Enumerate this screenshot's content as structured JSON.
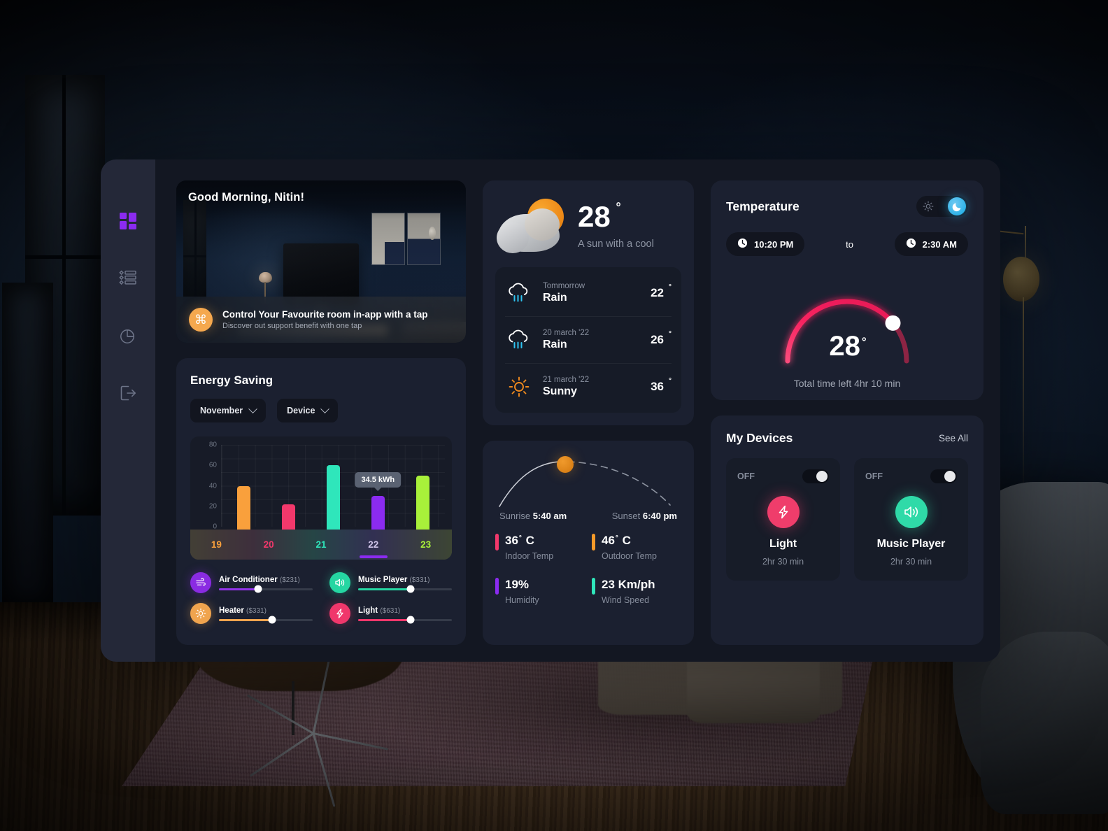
{
  "sidebar": {
    "items": [
      {
        "icon": "grid-dashboard-icon",
        "label": "Dashboard",
        "active": true
      },
      {
        "icon": "list-icon",
        "label": "Devices List",
        "active": false
      },
      {
        "icon": "pie-chart-icon",
        "label": "Statistics",
        "active": false
      },
      {
        "icon": "logout-icon",
        "label": "Log Out",
        "active": false
      }
    ]
  },
  "hero": {
    "greeting": "Good Morning, Nitin!",
    "banner_title": "Control Your Favourite room in-app with a tap",
    "banner_subtitle": "Discover out support benefit with one tap",
    "badge_icon": "command-icon",
    "badge_glyph": "⌘",
    "badge_color": "#f5a84e"
  },
  "energy": {
    "title": "Energy Saving",
    "filters": [
      {
        "label": "November",
        "icon": "chevron-down-icon"
      },
      {
        "label": "Device",
        "icon": "chevron-down-icon"
      }
    ],
    "tooltip": "34.5 kWh",
    "devices": [
      {
        "name": "Air Conditioner",
        "price": "($231)",
        "icon": "air-conditioner-icon",
        "color": "#8a2be2",
        "accent": "#9333ea",
        "value": 42
      },
      {
        "name": "Music Player",
        "price": "($331)",
        "icon": "speaker-icon",
        "color": "#25d6a2",
        "accent": "#25d6a2",
        "value": 56
      },
      {
        "name": "Heater",
        "price": "($331)",
        "icon": "sun-heater-icon",
        "color": "#f0a44e",
        "accent": "#f0a44e",
        "value": 57
      },
      {
        "name": "Light",
        "price": "($631)",
        "icon": "bolt-icon",
        "color": "#f0376b",
        "accent": "#f0376b",
        "value": 56
      }
    ]
  },
  "chart_data": {
    "type": "bar",
    "title": "Energy Saving",
    "categories": [
      "19",
      "20",
      "21",
      "22",
      "23"
    ],
    "values": [
      40,
      22,
      60,
      30,
      50
    ],
    "colors": [
      "#f9a03c",
      "#f2386b",
      "#2fe6bb",
      "#8b2bf0",
      "#a8f03a"
    ],
    "ylabel": "",
    "xlabel": "",
    "ylim": [
      0,
      80
    ],
    "yticks": [
      0,
      20,
      40,
      60,
      80
    ],
    "grid": true,
    "legend": false,
    "annotations": [
      {
        "category": "22",
        "text": "34.5 kWh"
      }
    ],
    "units": "kWh"
  },
  "weather": {
    "icon": "sun-behind-cloud-icon",
    "temperature": "28",
    "degree": "°",
    "description": "A sun with a cool",
    "forecast": [
      {
        "day": "Tommorrow",
        "condition": "Rain",
        "temp": "22",
        "icon": "rain-cloud-icon"
      },
      {
        "day": "20 march '22",
        "condition": "Rain",
        "temp": "26",
        "icon": "rain-cloud-icon"
      },
      {
        "day": "21 march '22",
        "condition": "Sunny",
        "temp": "36",
        "icon": "sun-icon"
      }
    ]
  },
  "sun": {
    "sunrise_label": "Sunrise",
    "sunrise_value": "5:40 am",
    "sunset_label": "Sunset",
    "sunset_value": "6:40 pm",
    "metrics": [
      {
        "value": "36",
        "unit": "C",
        "degree": "°",
        "label": "Indoor Temp",
        "color": "#f2386b"
      },
      {
        "value": "46",
        "unit": "C",
        "degree": "°",
        "label": "Outdoor Temp",
        "color": "#f59a29"
      },
      {
        "value": "19%",
        "unit": "",
        "degree": "",
        "label": "Humidity",
        "color": "#8b2bf0"
      },
      {
        "value": "23 Km/ph",
        "unit": "",
        "degree": "",
        "label": "Wind Speed",
        "color": "#2fe6bb"
      }
    ]
  },
  "temperature": {
    "title": "Temperature",
    "toggle": {
      "sun_icon": "sun-icon",
      "moon_icon": "moon-icon",
      "active": "moon",
      "active_color": "#2fb3e8"
    },
    "start_time": "10:20 PM",
    "end_time": "2:30 AM",
    "separator": "to",
    "clock_icon": "clock-icon",
    "gauge_value": "28",
    "gauge_degree": "°",
    "gauge_percent": 78,
    "gauge_color": "#f41f5e",
    "caption": "Total time left 4hr 10 min"
  },
  "devices": {
    "title": "My Devices",
    "see_all": "See All",
    "items": [
      {
        "state": "OFF",
        "name": "Light",
        "time": "2hr 30 min",
        "icon": "bolt-icon",
        "color": "#ef3d6b",
        "on": false
      },
      {
        "state": "OFF",
        "name": "Music Player",
        "time": "2hr 30 min",
        "icon": "speaker-icon",
        "color": "#2fdaa8",
        "on": false
      }
    ]
  }
}
